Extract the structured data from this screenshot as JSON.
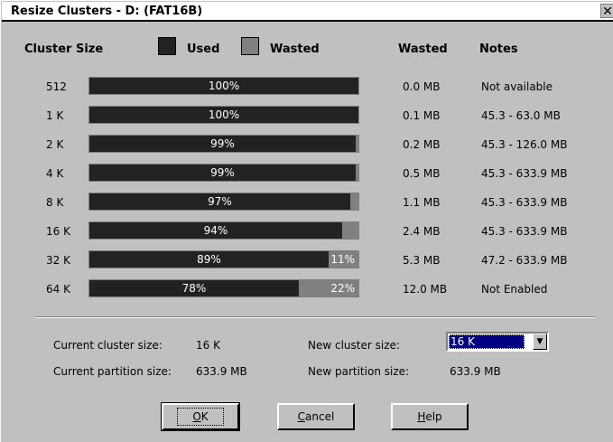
{
  "window": {
    "title": "Resize Clusters - D: (FAT16B)",
    "close_glyph": "✕"
  },
  "headers": {
    "cluster_size": "Cluster Size",
    "used": "Used",
    "wasted_legend": "Wasted",
    "wasted": "Wasted",
    "notes": "Notes"
  },
  "colors": {
    "used": "#222222",
    "wasted": "#808080",
    "selection": "#000080"
  },
  "rows": [
    {
      "size": "512",
      "used_pct": 100,
      "used_label": "100%",
      "wasted_label": "",
      "wasted_mb": "0.0 MB",
      "note": "Not available"
    },
    {
      "size": "1 K",
      "used_pct": 100,
      "used_label": "100%",
      "wasted_label": "",
      "wasted_mb": "0.1 MB",
      "note": "45.3 - 63.0 MB"
    },
    {
      "size": "2 K",
      "used_pct": 99,
      "used_label": "99%",
      "wasted_label": "",
      "wasted_mb": "0.2 MB",
      "note": "45.3 - 126.0 MB"
    },
    {
      "size": "4 K",
      "used_pct": 99,
      "used_label": "99%",
      "wasted_label": "",
      "wasted_mb": "0.5 MB",
      "note": "45.3 - 633.9 MB"
    },
    {
      "size": "8 K",
      "used_pct": 97,
      "used_label": "97%",
      "wasted_label": "",
      "wasted_mb": "1.1 MB",
      "note": "45.3 - 633.9 MB"
    },
    {
      "size": "16 K",
      "used_pct": 94,
      "used_label": "94%",
      "wasted_label": "",
      "wasted_mb": "2.4 MB",
      "note": "45.3 - 633.9 MB"
    },
    {
      "size": "32 K",
      "used_pct": 89,
      "used_label": "89%",
      "wasted_label": "11%",
      "wasted_mb": "5.3 MB",
      "note": "47.2 - 633.9 MB"
    },
    {
      "size": "64 K",
      "used_pct": 78,
      "used_label": "78%",
      "wasted_label": "22%",
      "wasted_mb": "12.0 MB",
      "note": "Not Enabled"
    }
  ],
  "info": {
    "current_cluster_label": "Current cluster size:",
    "current_cluster_value": "16 K",
    "current_partition_label": "Current partition size:",
    "current_partition_value": "633.9 MB",
    "new_cluster_label": "New cluster size:",
    "new_cluster_value": "16 K",
    "new_partition_label": "New partition size:",
    "new_partition_value": "633.9 MB"
  },
  "buttons": {
    "ok": {
      "mnemonic": "O",
      "rest": "K"
    },
    "cancel": {
      "mnemonic": "C",
      "rest": "ancel"
    },
    "help": {
      "mnemonic": "H",
      "rest": "elp"
    }
  },
  "icons": {
    "dropdown_arrow": "▼"
  }
}
